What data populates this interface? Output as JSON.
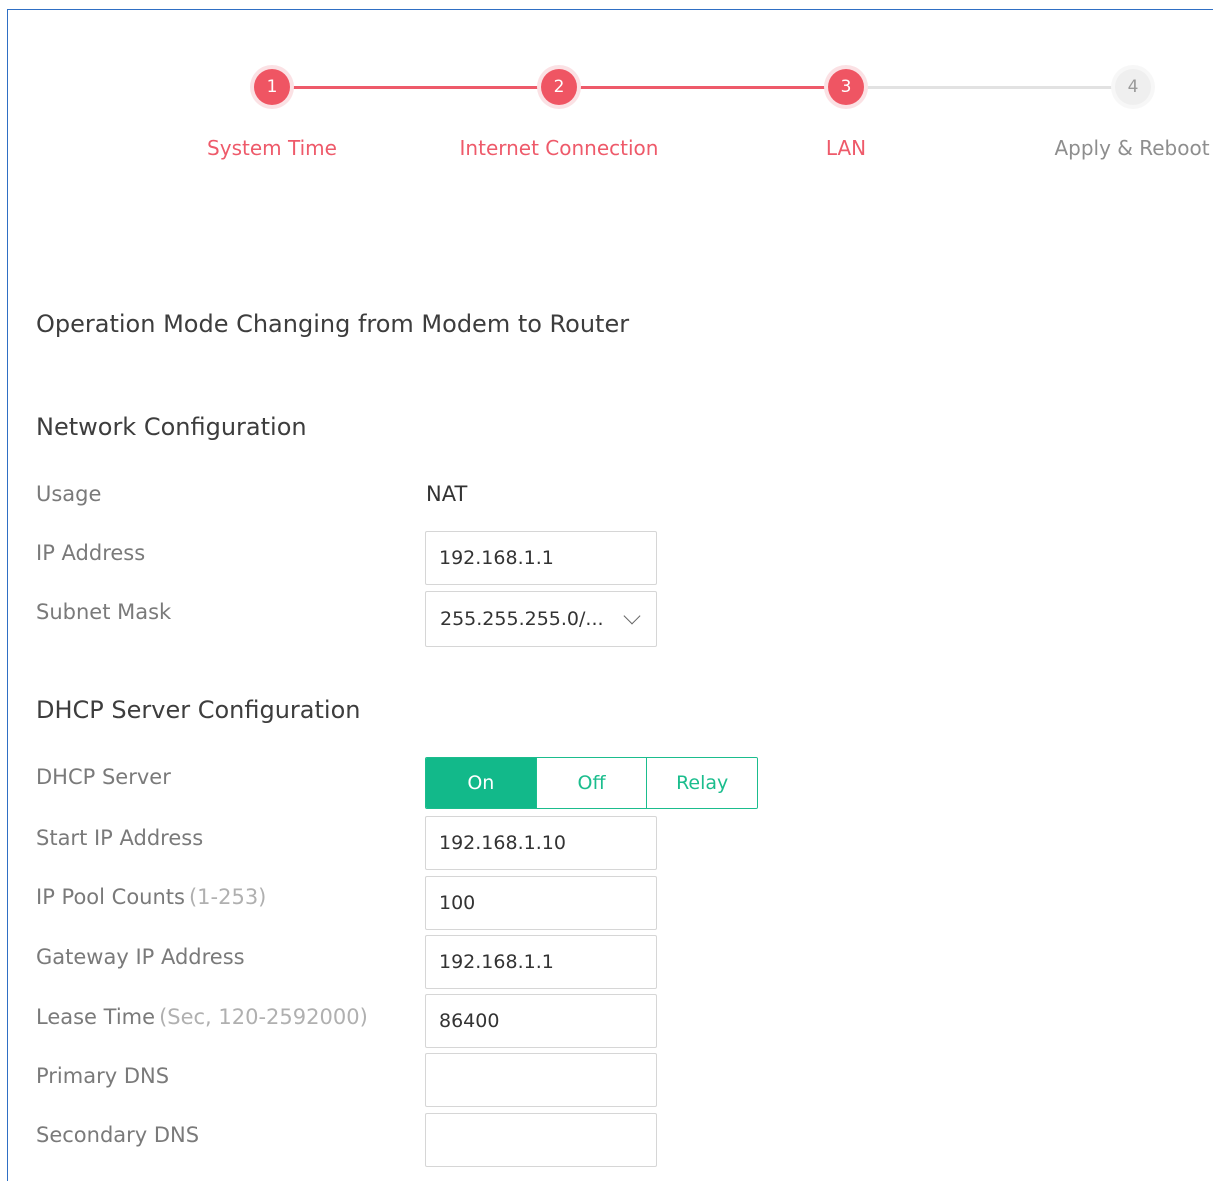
{
  "stepper": {
    "steps": [
      {
        "number": "1",
        "label": "System Time",
        "state": "completed"
      },
      {
        "number": "2",
        "label": "Internet Connection",
        "state": "completed"
      },
      {
        "number": "3",
        "label": "LAN",
        "state": "current"
      },
      {
        "number": "4",
        "label": "Apply & Reboot",
        "state": "pending"
      }
    ]
  },
  "page": {
    "mode_heading": "Operation Mode Changing from Modem to Router"
  },
  "network": {
    "heading": "Network Configuration",
    "usage_label": "Usage",
    "usage_value": "NAT",
    "ip_label": "IP Address",
    "ip_value": "192.168.1.1",
    "subnet_label": "Subnet Mask",
    "subnet_value": "255.255.255.0/..."
  },
  "dhcp": {
    "heading": "DHCP Server Configuration",
    "server_label": "DHCP Server",
    "server_options": [
      "On",
      "Off",
      "Relay"
    ],
    "server_selected": "On",
    "start_ip_label": "Start IP Address",
    "start_ip_value": "192.168.1.10",
    "pool_label": "IP Pool Counts",
    "pool_hint": "(1-253)",
    "pool_value": "100",
    "gateway_label": "Gateway IP Address",
    "gateway_value": "192.168.1.1",
    "lease_label": "Lease Time",
    "lease_hint": "(Sec, 120-2592000)",
    "lease_value": "86400",
    "primary_dns_label": "Primary DNS",
    "primary_dns_value": "",
    "secondary_dns_label": "Secondary DNS",
    "secondary_dns_value": ""
  },
  "colors": {
    "step_active": "#ee5a6a",
    "step_inactive": "#e2e2e2",
    "toggle_accent": "#12b98a",
    "frame_border": "#2f6fc4"
  }
}
